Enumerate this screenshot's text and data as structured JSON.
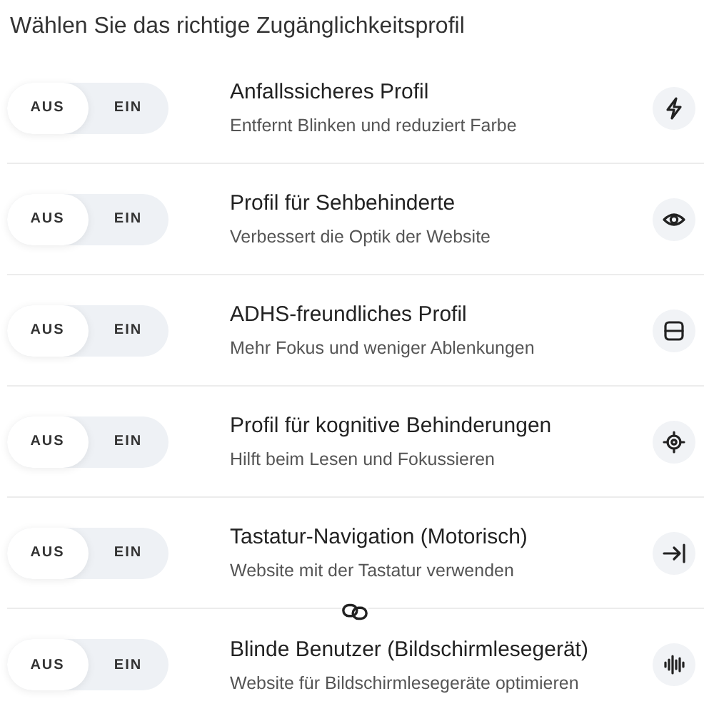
{
  "heading": "Wählen Sie das richtige Zugänglichkeitsprofil",
  "profiles": [
    {
      "title": "Anfallssicheres Profil",
      "description": "Entfernt Blinken und reduziert Farbe",
      "options": [
        {
          "label": "AUS",
          "selected": true
        },
        {
          "label": "EIN",
          "selected": false
        }
      ]
    },
    {
      "title": "Profil für Sehbehinderte",
      "description": "Verbessert die Optik der Website",
      "options": [
        {
          "label": "AUS",
          "selected": true
        },
        {
          "label": "EIN",
          "selected": false
        }
      ]
    },
    {
      "title": "ADHS-freundliches Profil",
      "description": "Mehr Fokus und weniger Ablenkungen",
      "options": [
        {
          "label": "AUS",
          "selected": true
        },
        {
          "label": "EIN",
          "selected": false
        }
      ]
    },
    {
      "title": "Profil für kognitive Behinderungen",
      "description": "Hilft beim Lesen und Fokussieren",
      "options": [
        {
          "label": "AUS",
          "selected": true
        },
        {
          "label": "EIN",
          "selected": false
        }
      ]
    },
    {
      "title": "Tastatur-Navigation (Motorisch)",
      "description": "Website mit der Tastatur verwenden",
      "options": [
        {
          "label": "AUS",
          "selected": true
        },
        {
          "label": "EIN",
          "selected": false
        }
      ]
    },
    {
      "title": "Blinde Benutzer (Bildschirmlesegerät)",
      "description": "Website für Bildschirmlesegeräte optimieren",
      "options": [
        {
          "label": "AUS",
          "selected": true
        },
        {
          "label": "EIN",
          "selected": false
        }
      ]
    }
  ]
}
